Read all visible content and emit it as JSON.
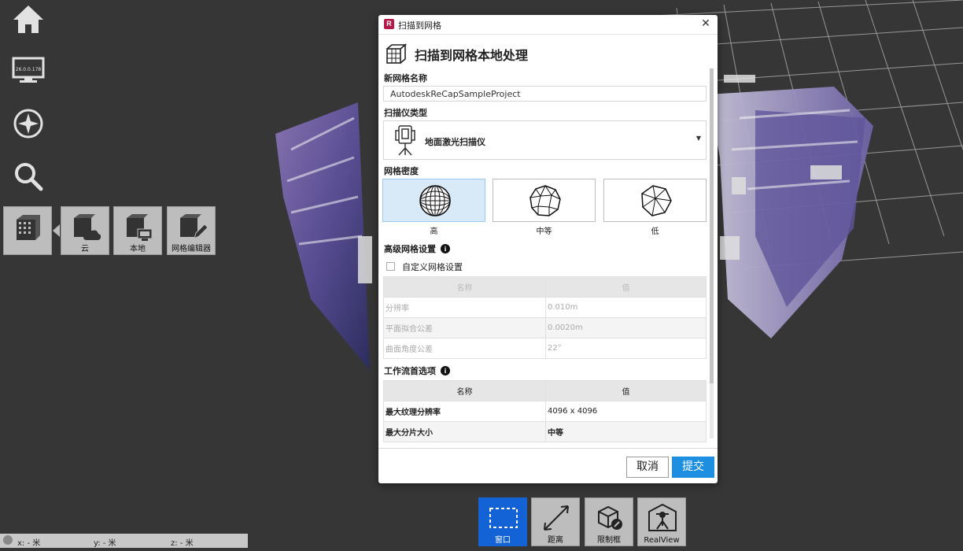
{
  "dialog": {
    "title": "扫描到网格",
    "heading": "扫描到网格本地处理",
    "name_label": "新网格名称",
    "name_value": "AutodeskReCapSampleProject",
    "scanner_label": "扫描仪类型",
    "scanner_value": "地面激光扫描仪",
    "density_label": "网格密度",
    "density_options": [
      {
        "label": "高",
        "selected": true
      },
      {
        "label": "中等",
        "selected": false
      },
      {
        "label": "低",
        "selected": false
      }
    ],
    "advanced_label": "高级网格设置",
    "custom_label": "自定义网格设置",
    "custom_checked": false,
    "advanced_table": {
      "headers": [
        "名称",
        "值"
      ],
      "rows": [
        [
          "分辨率",
          "0.010m"
        ],
        [
          "平面拟合公差",
          "0.0020m"
        ],
        [
          "曲面角度公差",
          "22°"
        ]
      ]
    },
    "workflow_label": "工作流首选项",
    "workflow_table": {
      "headers": [
        "名称",
        "值"
      ],
      "rows": [
        [
          "最大纹理分辨率",
          "4096 x 4096"
        ],
        [
          "最大分片大小",
          "中等"
        ]
      ]
    },
    "cancel_label": "取消",
    "submit_label": "提交",
    "info_glyph": "i",
    "close_glyph": "✕",
    "logo_letter": "R"
  },
  "left_toolbar": {
    "items": [
      "home-icon",
      "ip-monitor-icon",
      "compass-icon",
      "search-icon"
    ],
    "monitor_ip": "26.0.0.178",
    "mesh_tiles": [
      {
        "label": "",
        "icon": "mesh-icon"
      },
      {
        "label": "云",
        "icon": "mesh-cloud-icon"
      },
      {
        "label": "本地",
        "icon": "mesh-local-icon"
      },
      {
        "label": "网格编辑器",
        "icon": "mesh-editor-icon"
      }
    ]
  },
  "bottom_tools": [
    {
      "label": "窗口",
      "active": true,
      "icon": "window-select-icon"
    },
    {
      "label": "距离",
      "active": false,
      "icon": "distance-icon"
    },
    {
      "label": "限制框",
      "active": false,
      "icon": "limit-box-icon"
    },
    {
      "label": "RealView",
      "active": false,
      "icon": "realview-icon"
    }
  ],
  "coords": {
    "x": "x: - 米",
    "y": "y: - 米",
    "z": "z: - 米"
  },
  "colors": {
    "accent": "#1e8fe0",
    "active_tool": "#1463d6",
    "background": "#363636"
  }
}
